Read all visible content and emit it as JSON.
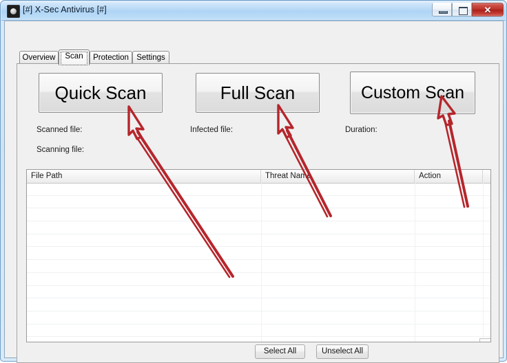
{
  "window": {
    "title": "[#] X-Sec Antivirus [#]",
    "icon": "app-shield-icon",
    "controls": {
      "minimize": "minimize-icon",
      "maximize": "maximize-icon",
      "close_label": "✕"
    }
  },
  "tabs": [
    {
      "label": "Overview",
      "active": false
    },
    {
      "label": "Scan",
      "active": true
    },
    {
      "label": "Protection",
      "active": false
    },
    {
      "label": "Settings",
      "active": false
    }
  ],
  "scan_buttons": {
    "quick": "Quick Scan",
    "full": "Full Scan",
    "custom": "Custom Scan"
  },
  "status": {
    "scanned_file": "Scanned file:",
    "scanning_file": "Scanning file:",
    "infected_file": "Infected file:",
    "duration": "Duration:",
    "scanned_value": "",
    "scanning_value": "",
    "infected_value": "",
    "duration_value": ""
  },
  "results_table": {
    "columns": [
      "File Path",
      "Threat Name",
      "Action",
      ""
    ],
    "rows": [],
    "empty_row_count": 12
  },
  "footer": {
    "select_all": "Select All",
    "unselect_all": "Unselect All"
  },
  "annotations": {
    "count": 3,
    "color": "#b5262c",
    "items": [
      {
        "name": "arrow-to-quick-scan",
        "points_at": "Quick Scan"
      },
      {
        "name": "arrow-to-full-scan",
        "points_at": "Full Scan"
      },
      {
        "name": "arrow-to-custom-scan",
        "points_at": "Custom Scan"
      }
    ]
  },
  "colors": {
    "titlebar": "#b6d8f6",
    "frame": "#f0f0f0",
    "close_button": "#bb2f27",
    "annotation_red": "#b5262c"
  }
}
